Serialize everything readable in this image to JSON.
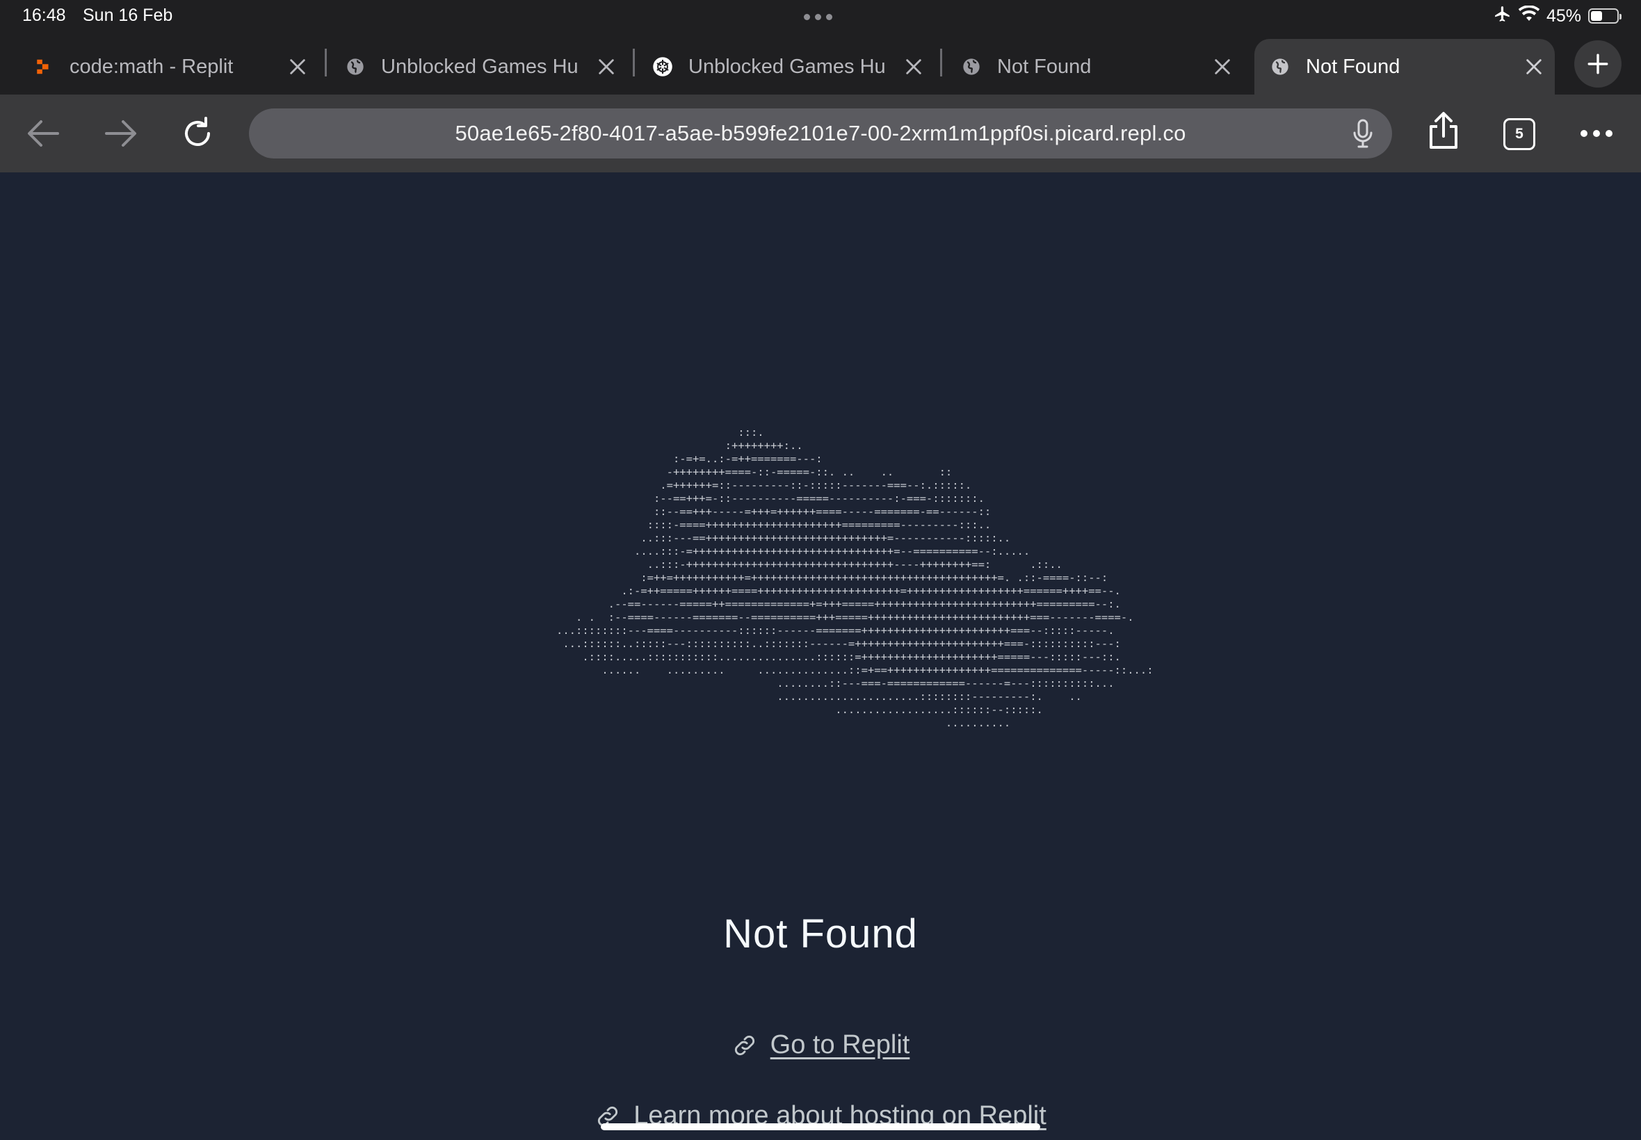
{
  "status_bar": {
    "time": "16:48",
    "date": "Sun 16 Feb",
    "battery_percent": "45%",
    "battery_level": 0.45
  },
  "tabs": [
    {
      "title": "code:math - Replit",
      "icon": "replit-logo-icon",
      "active": false
    },
    {
      "title": "Unblocked Games Hu",
      "icon": "globe-icon",
      "active": false
    },
    {
      "title": "Unblocked Games Hu",
      "icon": "openai-logo-icon",
      "active": false
    },
    {
      "title": "Not Found",
      "icon": "globe-icon",
      "active": false
    },
    {
      "title": "Not Found",
      "icon": "globe-icon",
      "active": true
    }
  ],
  "toolbar": {
    "url": "50ae1e65-2f80-4017-a5ae-b599fe2101e7-00-2xrm1m1ppf0si.picard.repl.co",
    "tab_count": "5"
  },
  "page": {
    "ascii_art": "                            :::.\n                          :++++++++:..\n                  :-=+=..:-=++=======---:\n                 -++++++++====-::-=====-::. ..    ..       ::\n                .=++++++=::---------::-:::::-------===--:.:::::.\n               :--==+++=-::----------=====----------:-===-:::::::.\n               ::--==+++-----=+++=++++++====-----=======-==------::\n              ::::-====+++++++++++++++++++++=========---------:::..\n             ..:::---==++++++++++++++++++++++++++++=-----------:::::..\n            ....:::-=+++++++++++++++++++++++++++++++=--==========--:.....\n              ..:::-++++++++++++++++++++++++++++++++----++++++++==:      .::..\n             :=++=+++++++++++=++++++++++++++++++++++++++++++++++++++=. .::-====-::--:\n          .:-=++=====++++++====++++++++++++++++++++++=++++++++++++++++++======++++==--.\n        .--==------=====++=============+=+++=====+++++++++++++++++++++++++=========--:.\n   . .  :--====------=======--==========+++=====+++++++++++++++++++++++++===-------====-.\n...::::::::---====----------::::::------=======+++++++++++++++++++++++===--:::::-----.\n ...::::::..:::::---::::::::::..:::::::------=+++++++++++++++++++++++===-::::::::::---:\n    .::::.....:::::::::::...............::::::=+++++++++++++++++++++=====---:::::---::.\n       ......    .........     ..............::=+==++++++++++++++++==============-----::...:\n                                  ........::---===-============------=---::::::::::...\n                                  ......................::::::::---------:.    ..\n                                           ..................::::::--:::::.\n                                                            ..........",
    "title": "Not Found",
    "links": [
      {
        "label": "Go to Replit"
      },
      {
        "label": "Learn more about hosting on Replit"
      }
    ]
  },
  "colors": {
    "page_background": "#1c2333",
    "chrome_dark": "#1f1f21",
    "toolbar": "#3a3a3c",
    "urlbar": "#5b5b60",
    "replit_orange": "#f26207"
  }
}
